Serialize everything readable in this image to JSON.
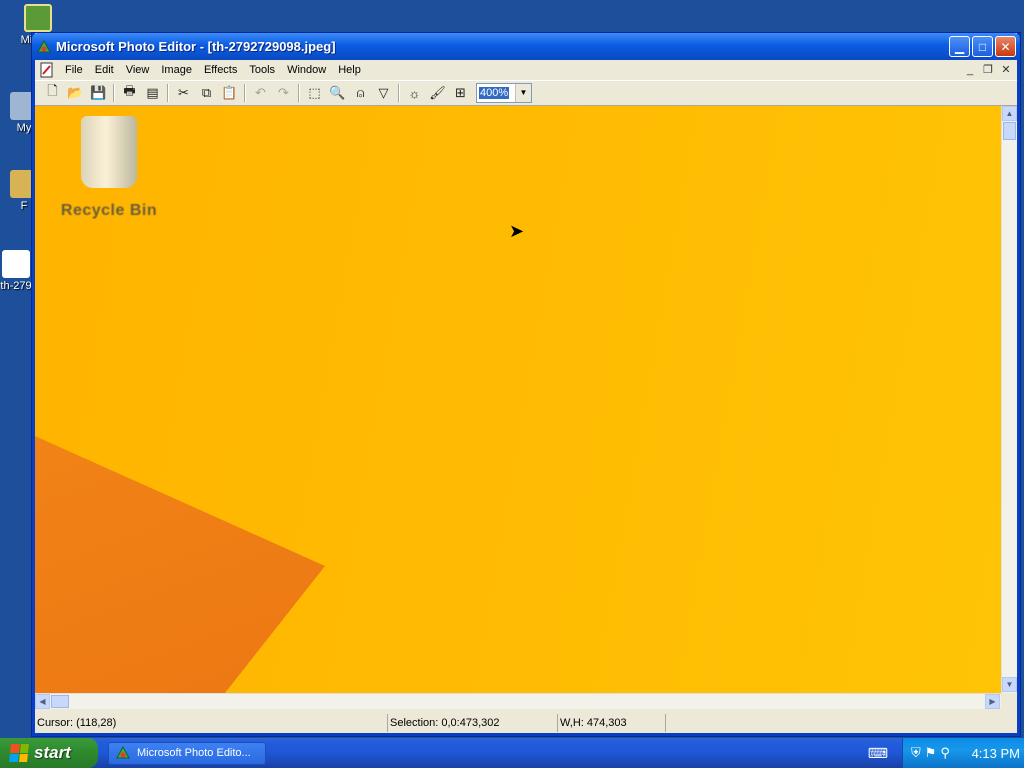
{
  "desktop": {
    "icons": [
      {
        "label": "Mic Ou"
      },
      {
        "label": "My"
      },
      {
        "label": "F"
      },
      {
        "label": "th-279"
      }
    ]
  },
  "window": {
    "title": "Microsoft Photo Editor - [th-2792729098.jpeg]",
    "menu": [
      "File",
      "Edit",
      "View",
      "Image",
      "Effects",
      "Tools",
      "Window",
      "Help"
    ],
    "zoom": "400%",
    "canvas": {
      "recycle_label": "Recycle Bin",
      "colors": {
        "background": "#ffb400",
        "shape": "#f08018"
      }
    }
  },
  "status": {
    "cursor": "Cursor: (118,28)",
    "selection": "Selection: 0,0:473,302",
    "size": "W,H: 474,303"
  },
  "taskbar": {
    "start": "start",
    "task_label": "Microsoft Photo Edito...",
    "clock": "4:13 PM"
  }
}
